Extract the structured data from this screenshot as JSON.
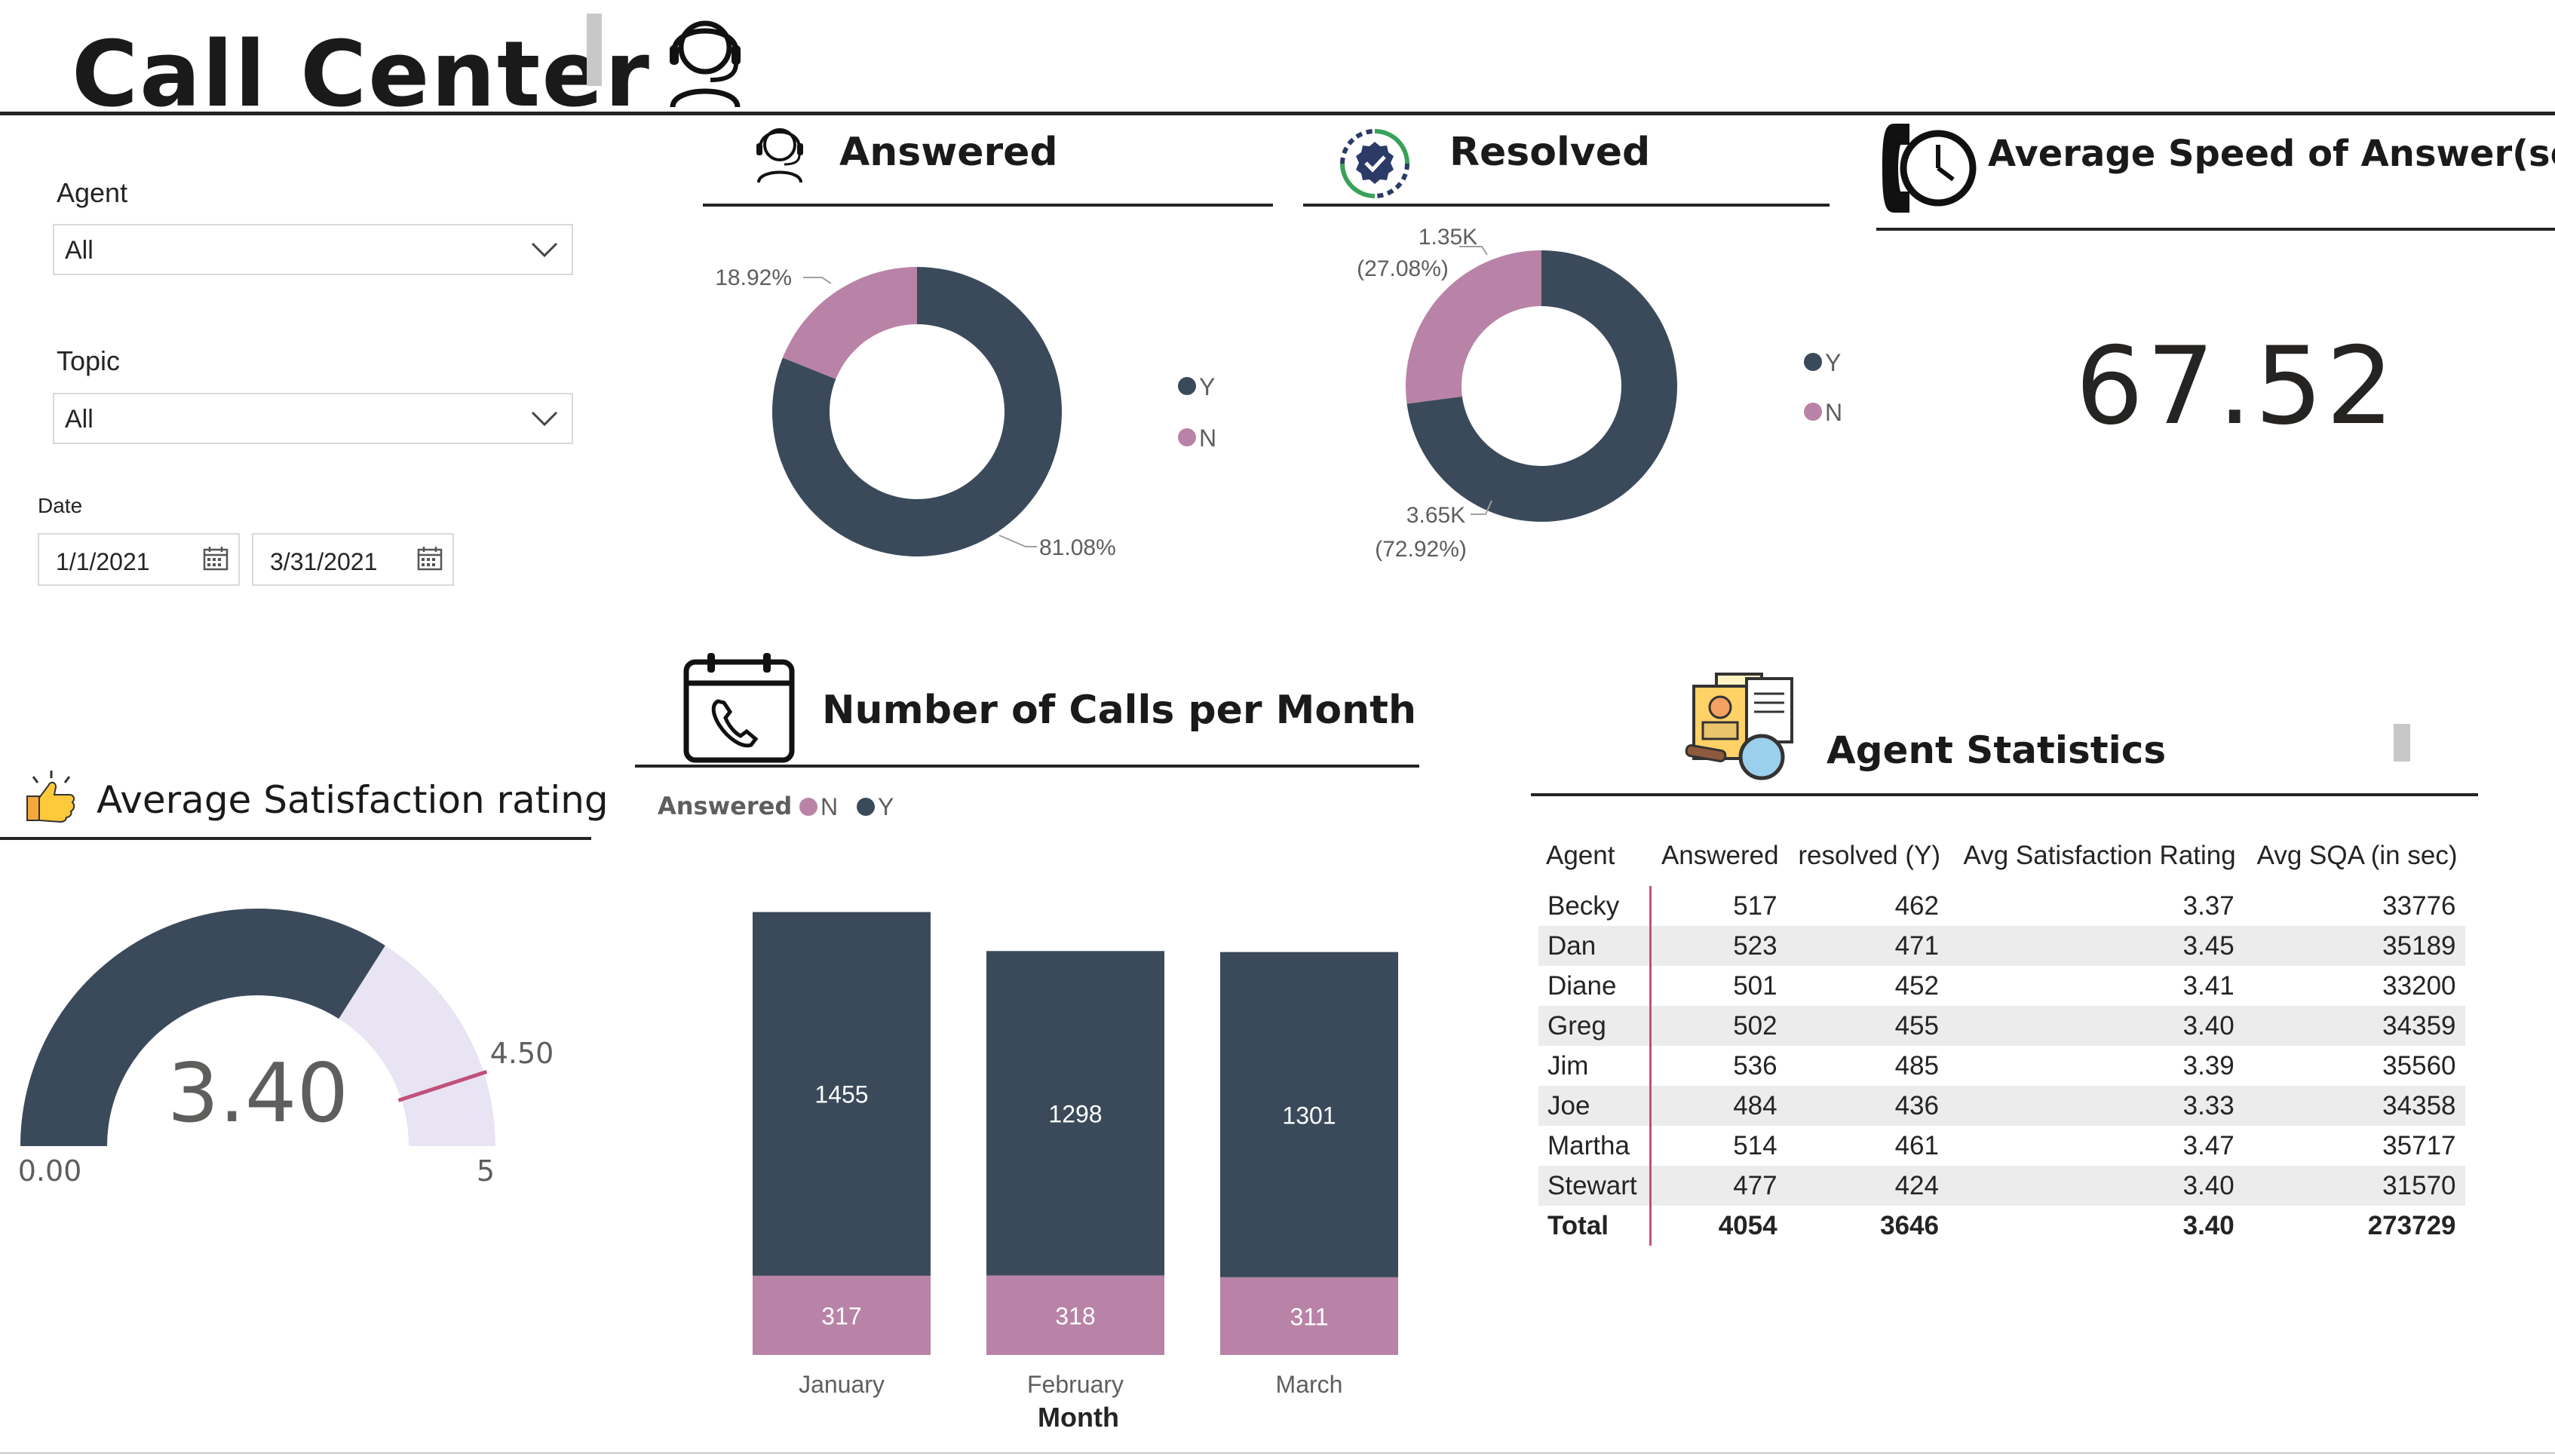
{
  "header": {
    "title": "Call Center"
  },
  "filters": {
    "agent": {
      "label": "Agent",
      "value": "All"
    },
    "topic": {
      "label": "Topic",
      "value": "All"
    },
    "date": {
      "label": "Date",
      "start": "1/1/2021",
      "end": "3/31/2021"
    }
  },
  "colors": {
    "dark": "#3a4a5a",
    "pink": "#b883a6",
    "gauge_bg": "#e8e4f4",
    "accent_line": "#c0507a"
  },
  "answered": {
    "title": "Answered",
    "slices": [
      {
        "name": "Y",
        "pct": 81.08,
        "label": "81.08%"
      },
      {
        "name": "N",
        "pct": 18.92,
        "label": "18.92%"
      }
    ],
    "legend": [
      "Y",
      "N"
    ]
  },
  "resolved": {
    "title": "Resolved",
    "slices": [
      {
        "name": "Y",
        "pct": 72.92,
        "label1": "3.65K",
        "label2": "(72.92%)"
      },
      {
        "name": "N",
        "pct": 27.08,
        "label1": "1.35K",
        "label2": "(27.08%)"
      }
    ],
    "legend": [
      "Y",
      "N"
    ]
  },
  "speed": {
    "title": "Average Speed of Answer(sec)",
    "value": "67.52"
  },
  "satisfaction": {
    "title": "Average Satisfaction rating",
    "value": 3.4,
    "value_label": "3.40",
    "min": 0,
    "min_label": "0.00",
    "max": 5,
    "max_label": "5",
    "target": 4.5,
    "target_label": "4.50"
  },
  "calls_per_month": {
    "title": "Number of Calls per Month",
    "legend_title": "Answered",
    "legend": [
      "N",
      "Y"
    ],
    "xlabel": "Month"
  },
  "chart_data": {
    "type": "bar",
    "stacked": true,
    "categories": [
      "January",
      "February",
      "March"
    ],
    "series": [
      {
        "name": "Y",
        "values": [
          1455,
          1298,
          1301
        ]
      },
      {
        "name": "N",
        "values": [
          317,
          318,
          311
        ]
      }
    ],
    "xlabel": "Month",
    "legend_title": "Answered",
    "legend_position": "top-left"
  },
  "agent_stats": {
    "title": "Agent Statistics",
    "columns": [
      "Agent",
      "Answered",
      "resolved (Y)",
      "Avg Satisfaction Rating",
      "Avg SQA (in sec)"
    ],
    "rows": [
      [
        "Becky",
        "517",
        "462",
        "3.37",
        "33776"
      ],
      [
        "Dan",
        "523",
        "471",
        "3.45",
        "35189"
      ],
      [
        "Diane",
        "501",
        "452",
        "3.41",
        "33200"
      ],
      [
        "Greg",
        "502",
        "455",
        "3.40",
        "34359"
      ],
      [
        "Jim",
        "536",
        "485",
        "3.39",
        "35560"
      ],
      [
        "Joe",
        "484",
        "436",
        "3.33",
        "34358"
      ],
      [
        "Martha",
        "514",
        "461",
        "3.47",
        "35717"
      ],
      [
        "Stewart",
        "477",
        "424",
        "3.40",
        "31570"
      ]
    ],
    "total": [
      "Total",
      "4054",
      "3646",
      "3.40",
      "273729"
    ]
  }
}
